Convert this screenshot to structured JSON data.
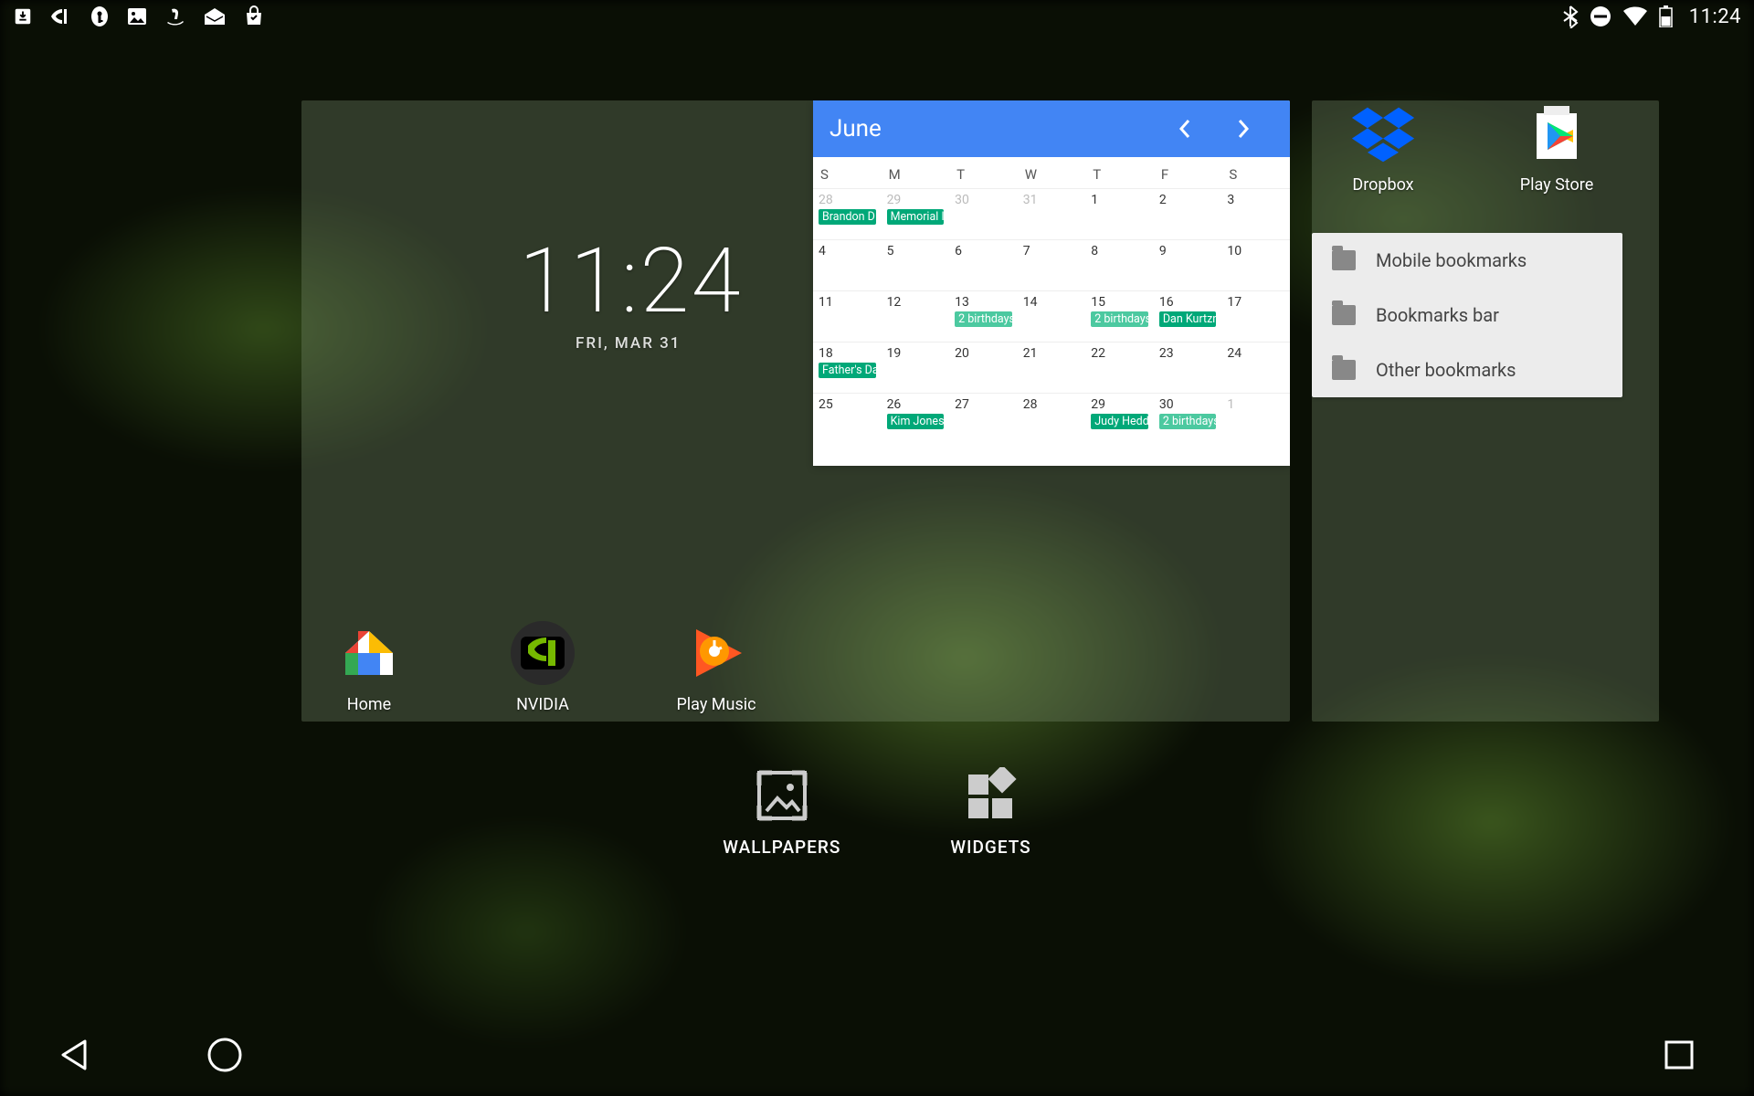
{
  "status": {
    "time": "11:24",
    "icons_left": [
      "download",
      "nvidia",
      "key",
      "image",
      "amazon",
      "mail",
      "shop"
    ],
    "icons_right": [
      "bluetooth",
      "dnd",
      "wifi",
      "battery"
    ]
  },
  "clock": {
    "time": "11:24",
    "date": "FRI, MAR 31"
  },
  "calendar": {
    "month": "June",
    "dow": [
      "S",
      "M",
      "T",
      "W",
      "T",
      "F",
      "S"
    ],
    "rows": [
      [
        {
          "n": "28",
          "dim": true,
          "ev": [
            "Brandon D"
          ]
        },
        {
          "n": "29",
          "dim": true,
          "ev": [
            "Memorial I"
          ]
        },
        {
          "n": "30",
          "dim": true
        },
        {
          "n": "31",
          "dim": true
        },
        {
          "n": "1"
        },
        {
          "n": "2"
        },
        {
          "n": "3"
        }
      ],
      [
        {
          "n": "4"
        },
        {
          "n": "5"
        },
        {
          "n": "6"
        },
        {
          "n": "7"
        },
        {
          "n": "8"
        },
        {
          "n": "9"
        },
        {
          "n": "10"
        }
      ],
      [
        {
          "n": "11"
        },
        {
          "n": "12"
        },
        {
          "n": "13",
          "ev": [
            "2 birthdays"
          ],
          "light": true
        },
        {
          "n": "14"
        },
        {
          "n": "15",
          "ev": [
            "2 birthdays"
          ],
          "light": true
        },
        {
          "n": "16",
          "ev": [
            "Dan Kurtzn"
          ]
        },
        {
          "n": "17"
        }
      ],
      [
        {
          "n": "18",
          "ev": [
            "Father's Da"
          ]
        },
        {
          "n": "19"
        },
        {
          "n": "20"
        },
        {
          "n": "21"
        },
        {
          "n": "22"
        },
        {
          "n": "23"
        },
        {
          "n": "24"
        }
      ],
      [
        {
          "n": "25"
        },
        {
          "n": "26",
          "ev": [
            "Kim Jones"
          ]
        },
        {
          "n": "27"
        },
        {
          "n": "28"
        },
        {
          "n": "29",
          "ev": [
            "Judy Hedd"
          ]
        },
        {
          "n": "30",
          "ev": [
            "2 birthdays"
          ],
          "light": true
        },
        {
          "n": "1",
          "dim": true
        }
      ]
    ]
  },
  "main_apps": [
    {
      "id": "home",
      "label": "Home"
    },
    {
      "id": "nvidia",
      "label": "NVIDIA"
    },
    {
      "id": "play-music",
      "label": "Play Music"
    }
  ],
  "side_apps": [
    {
      "id": "dropbox",
      "label": "Dropbox"
    },
    {
      "id": "play-store",
      "label": "Play Store"
    }
  ],
  "bookmarks": [
    {
      "label": "Mobile bookmarks"
    },
    {
      "label": "Bookmarks bar"
    },
    {
      "label": "Other bookmarks"
    }
  ],
  "overview_actions": {
    "wallpapers": "WALLPAPERS",
    "widgets": "WIDGETS"
  }
}
